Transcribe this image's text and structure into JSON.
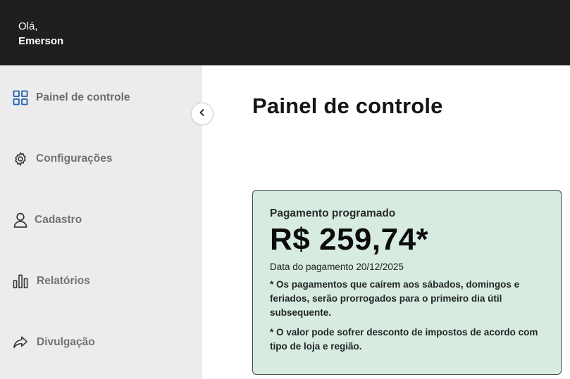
{
  "header": {
    "greeting": "Olá,",
    "user_name": "Emerson"
  },
  "sidebar": {
    "items": [
      {
        "label": "Painel de controle",
        "icon": "grid-icon",
        "active": true
      },
      {
        "label": "Configurações",
        "icon": "gear-icon"
      },
      {
        "label": "Cadastro",
        "icon": "user-icon"
      },
      {
        "label": "Relatórios",
        "icon": "bar-chart-icon"
      },
      {
        "label": "Divulgação",
        "icon": "share-icon"
      }
    ],
    "collapse_icon": "chevron-left-icon"
  },
  "main": {
    "title": "Painel de controle",
    "payment_card": {
      "title": "Pagamento programado",
      "amount": "R$ 259,74*",
      "date_text": "Data do pagamento 20/12/2025",
      "note_1": "* Os pagamentos que caírem aos sábados, domingos e feriados, serão prorrogados para o primeiro dia útil subsequente.",
      "note_2": "* O valor pode sofrer desconto de impostos de acordo com tipo de loja e região."
    }
  },
  "colors": {
    "topbar": "#1f1f1f",
    "sidebar": "#ececec",
    "accent_blue": "#1f5fb0",
    "card_bg": "#d7ebe1"
  }
}
